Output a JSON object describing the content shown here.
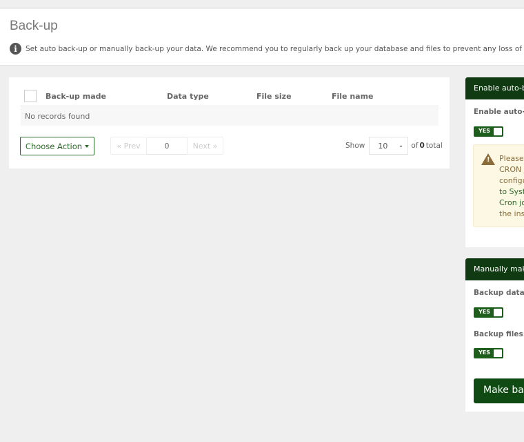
{
  "header": {
    "title": "Back-up",
    "subtitle": "Set auto back-up or manually back-up your data. We recommend you to regularly back up your database and files to prevent any loss of information.",
    "info_icon": "info-circle-icon"
  },
  "table": {
    "columns": [
      "Back-up made",
      "Data type",
      "File size",
      "File name"
    ],
    "empty_text": "No records found",
    "choose_action_label": "Choose Action",
    "pager": {
      "prev_label": "« Prev",
      "page_value": "0",
      "next_label": "Next »"
    },
    "show_label": "Show",
    "per_page": "10",
    "of_label": "of",
    "total_count": "0",
    "total_label": "total"
  },
  "auto_backup": {
    "heading": "Enable auto-ba",
    "field_label": "Enable auto-ba",
    "toggle_label": "YES",
    "toggle_on": true,
    "warning_icon": "warning-triangle-icon",
    "warning_lines": [
      "Please,",
      "CRON j",
      "configu",
      "to Syste",
      "Cron jo",
      "the inst"
    ]
  },
  "manual_backup": {
    "heading": "Manually make",
    "database_label": "Backup databa",
    "database_toggle": "YES",
    "files_label": "Backup files:",
    "files_toggle": "YES",
    "make_button_label": "Make bac"
  },
  "colors": {
    "brand_green": "#0f3a12",
    "toggle_green": "#1d5e1d",
    "outline_green": "#2d6a2d",
    "warning_bg": "#fcf8e3",
    "warning_text": "#8a6d3b"
  }
}
